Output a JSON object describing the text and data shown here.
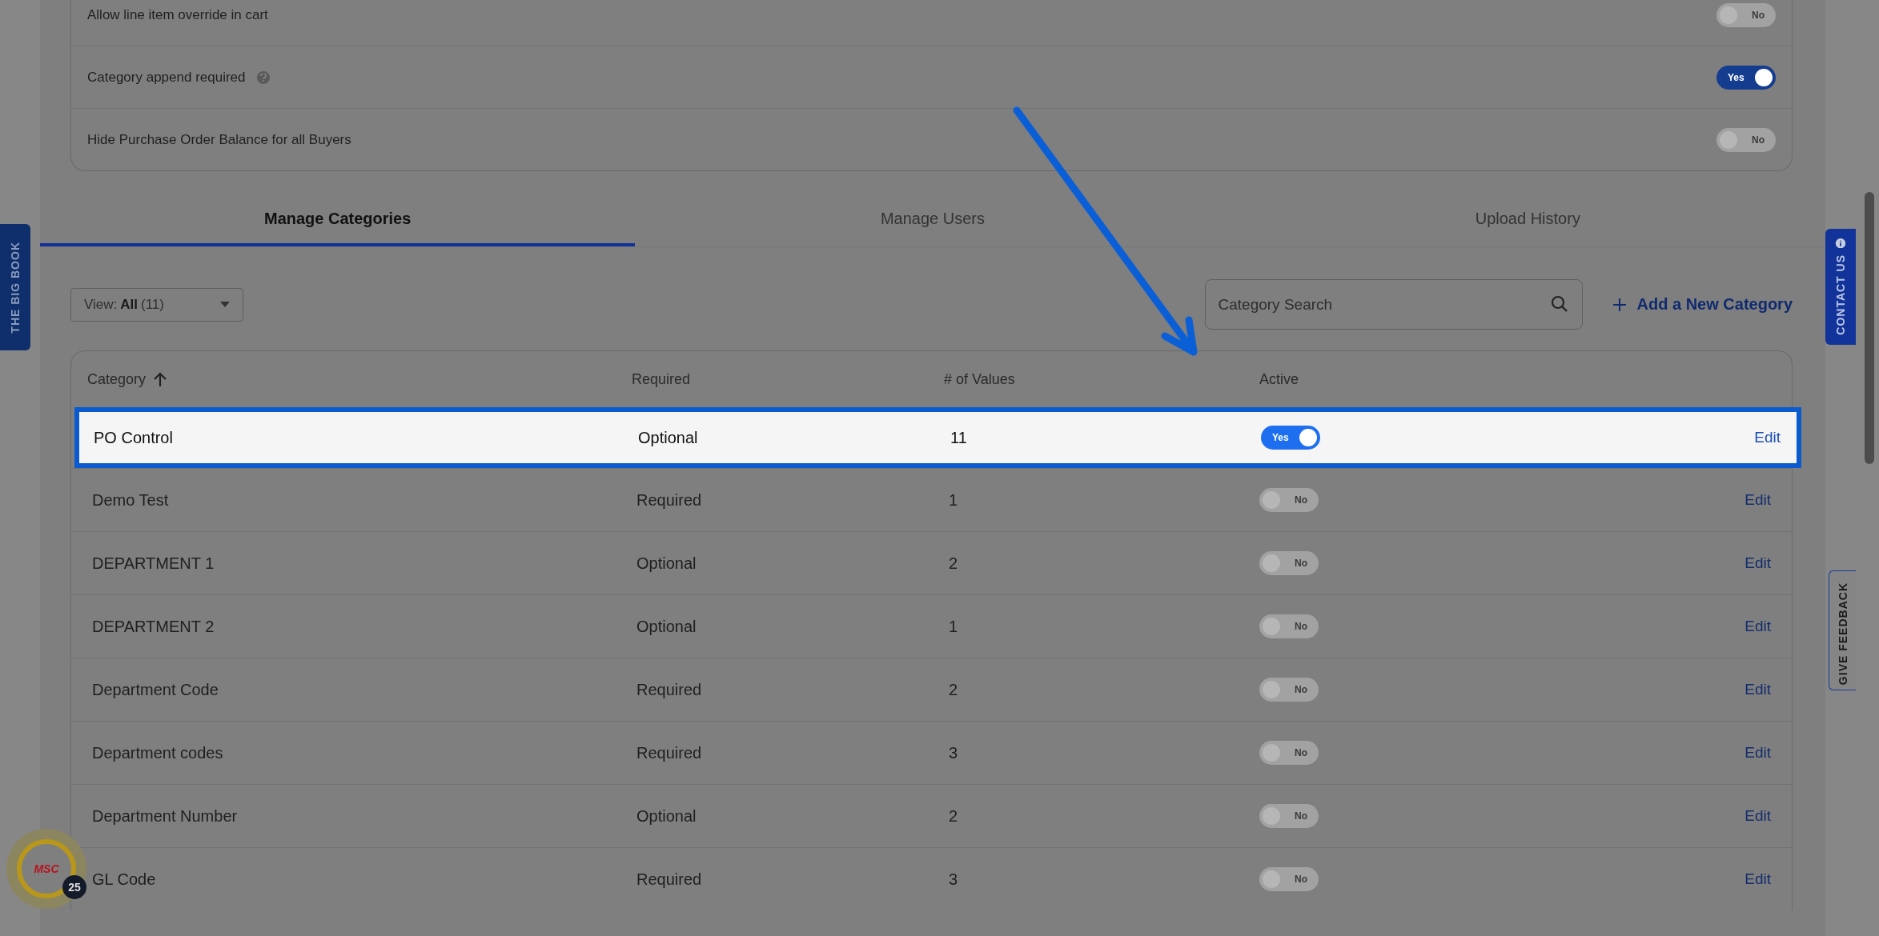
{
  "settings": [
    {
      "label": "Allow line item override in cart",
      "help": false,
      "toggle": {
        "on": false,
        "label": "No"
      }
    },
    {
      "label": "Category append required",
      "help": true,
      "toggle": {
        "on": true,
        "label": "Yes"
      }
    },
    {
      "label": "Hide Purchase Order Balance for all Buyers",
      "help": false,
      "toggle": {
        "on": false,
        "label": "No"
      }
    }
  ],
  "tabs": [
    {
      "label": "Manage Categories",
      "selected": true
    },
    {
      "label": "Manage Users",
      "selected": false
    },
    {
      "label": "Upload History",
      "selected": false
    }
  ],
  "view_filter": {
    "label": "View:",
    "value": "All",
    "count": "(11)"
  },
  "search": {
    "placeholder": "Category Search"
  },
  "add_button": "Add a New Category",
  "table": {
    "columns": [
      {
        "label": "Category",
        "sorted": true
      },
      {
        "label": "Required",
        "sorted": false
      },
      {
        "label": "# of Values",
        "sorted": false
      },
      {
        "label": "Active",
        "sorted": false
      }
    ],
    "rows": [
      {
        "category": "PO Control",
        "required": "Optional",
        "values": "11",
        "active": {
          "on": true,
          "label": "Yes"
        },
        "action": "Edit",
        "highlighted": true
      },
      {
        "category": "Demo Test",
        "required": "Required",
        "values": "1",
        "active": {
          "on": false,
          "label": "No"
        },
        "action": "Edit",
        "highlighted": false
      },
      {
        "category": "DEPARTMENT 1",
        "required": "Optional",
        "values": "2",
        "active": {
          "on": false,
          "label": "No"
        },
        "action": "Edit",
        "highlighted": false
      },
      {
        "category": "DEPARTMENT 2",
        "required": "Optional",
        "values": "1",
        "active": {
          "on": false,
          "label": "No"
        },
        "action": "Edit",
        "highlighted": false
      },
      {
        "category": "Department Code",
        "required": "Required",
        "values": "2",
        "active": {
          "on": false,
          "label": "No"
        },
        "action": "Edit",
        "highlighted": false
      },
      {
        "category": "Department codes",
        "required": "Required",
        "values": "3",
        "active": {
          "on": false,
          "label": "No"
        },
        "action": "Edit",
        "highlighted": false
      },
      {
        "category": "Department Number",
        "required": "Optional",
        "values": "2",
        "active": {
          "on": false,
          "label": "No"
        },
        "action": "Edit",
        "highlighted": false
      },
      {
        "category": "GL Code",
        "required": "Required",
        "values": "3",
        "active": {
          "on": false,
          "label": "No"
        },
        "action": "Edit",
        "highlighted": false
      }
    ]
  },
  "side_tabs": {
    "left": "THE BIG BOOK",
    "contact": "CONTACT US",
    "feedback": "GIVE FEEDBACK"
  },
  "badge": {
    "logo": "MSC",
    "count": "25"
  }
}
